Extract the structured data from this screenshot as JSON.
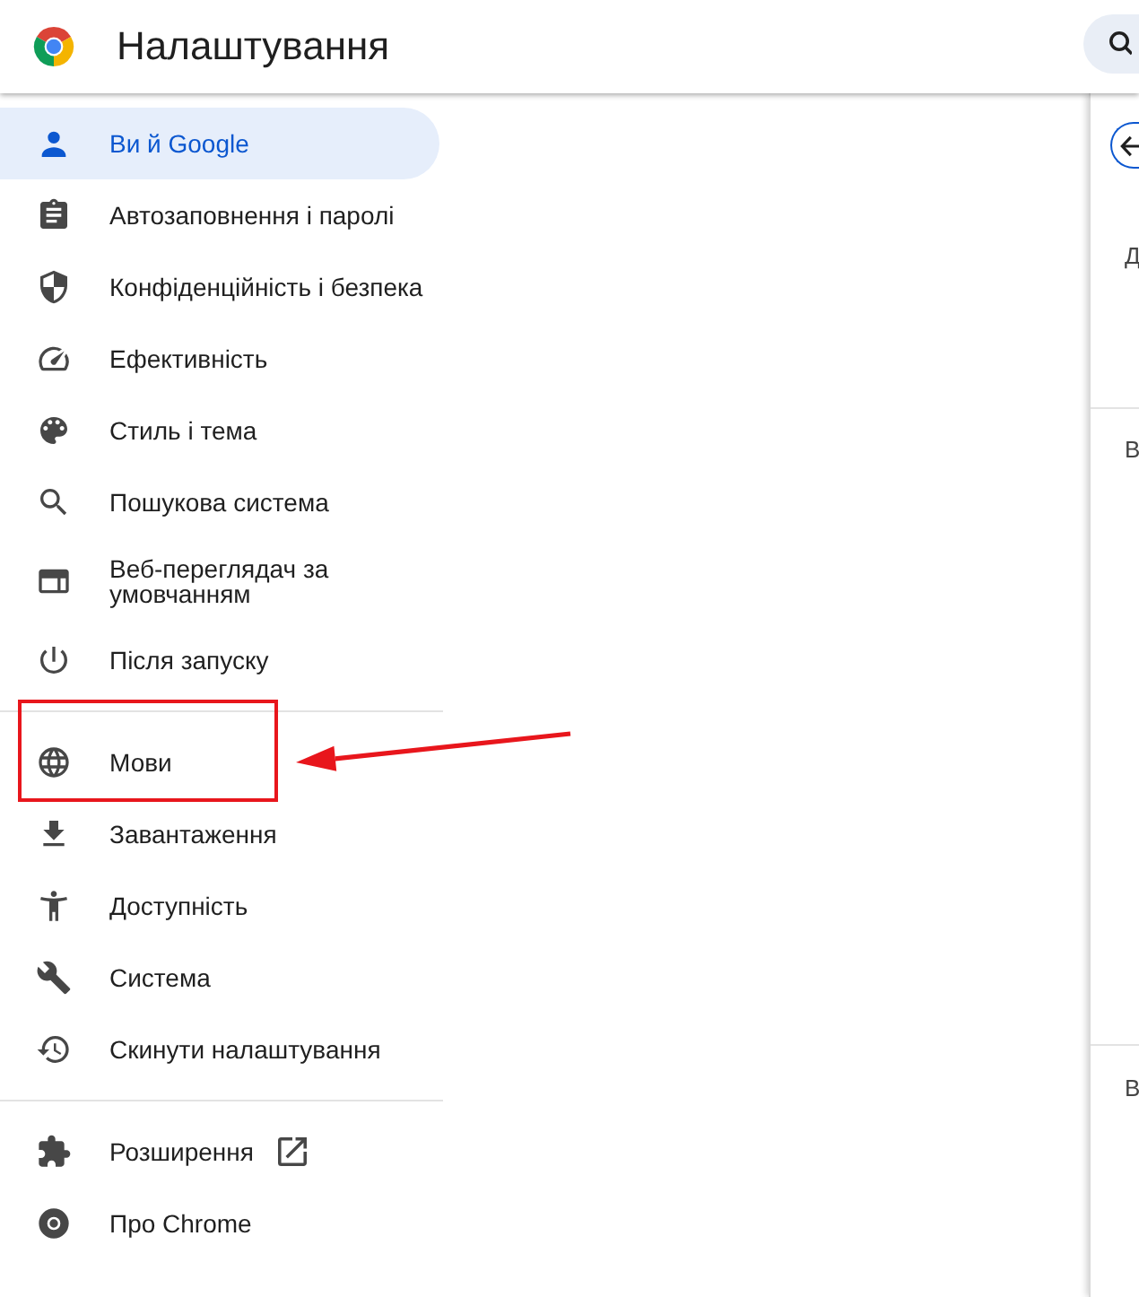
{
  "window": {
    "title": "Налаштування"
  },
  "sidebar": {
    "sections": [
      {
        "items": [
          {
            "label": "Ви й Google",
            "selected": true,
            "highlighted": false,
            "external": false
          },
          {
            "label": "Автозаповнення і паролі",
            "selected": false,
            "highlighted": false,
            "external": false
          },
          {
            "label": "Конфіденційність і безпека",
            "selected": false,
            "highlighted": false,
            "external": false
          },
          {
            "label": "Ефективність",
            "selected": false,
            "highlighted": false,
            "external": false
          },
          {
            "label": "Стиль і тема",
            "selected": false,
            "highlighted": false,
            "external": false
          },
          {
            "label": "Пошукова система",
            "selected": false,
            "highlighted": false,
            "external": false
          },
          {
            "label": "Веб-переглядач за умовчанням",
            "selected": false,
            "highlighted": false,
            "external": false
          },
          {
            "label": "Після запуску",
            "selected": false,
            "highlighted": false,
            "external": false
          }
        ]
      },
      {
        "items": [
          {
            "label": "Мови",
            "selected": false,
            "highlighted": true,
            "external": false
          },
          {
            "label": "Завантаження",
            "selected": false,
            "highlighted": false,
            "external": false
          },
          {
            "label": "Доступність",
            "selected": false,
            "highlighted": false,
            "external": false
          },
          {
            "label": "Система",
            "selected": false,
            "highlighted": false,
            "external": false
          },
          {
            "label": "Скинути налаштування",
            "selected": false,
            "highlighted": false,
            "external": false
          }
        ]
      },
      {
        "items": [
          {
            "label": "Розширення",
            "selected": false,
            "highlighted": false,
            "external": true
          },
          {
            "label": "Про Chrome",
            "selected": false,
            "highlighted": false,
            "external": false
          }
        ]
      }
    ]
  },
  "right_panel": {
    "sections": [
      {
        "text": "Д"
      },
      {
        "text": "В"
      },
      {
        "text": "В"
      }
    ]
  }
}
